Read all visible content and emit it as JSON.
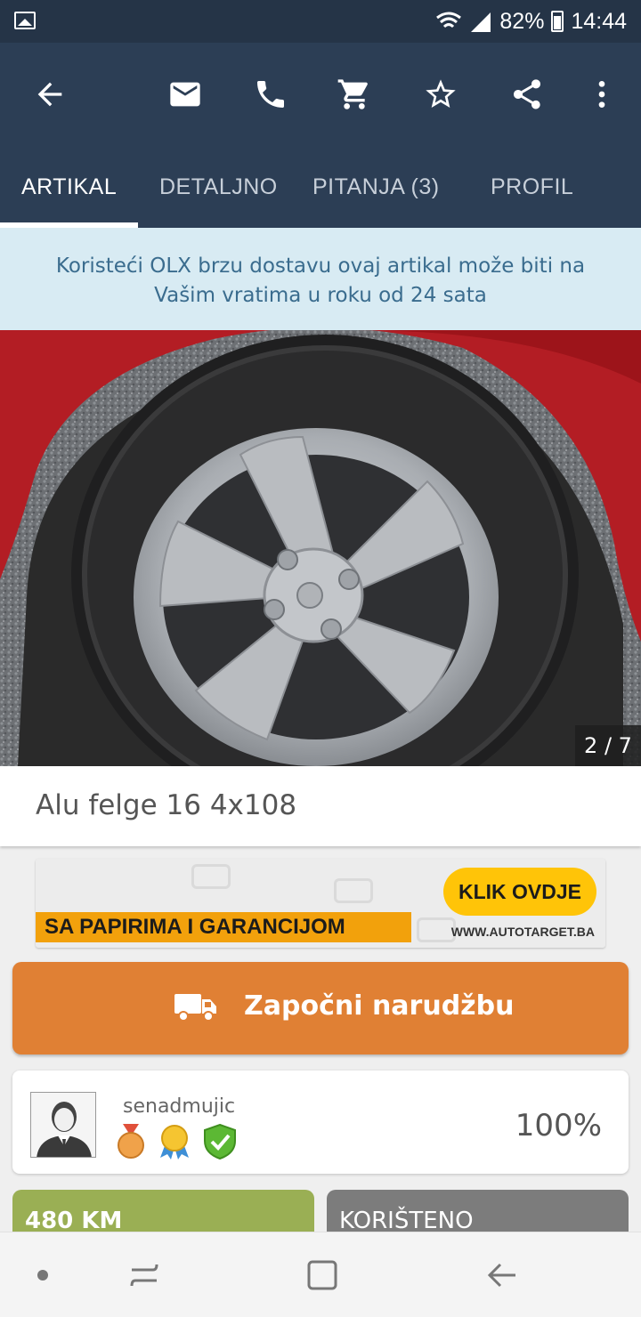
{
  "status_bar": {
    "battery": "82%",
    "time": "14:44"
  },
  "app_bar": {
    "icons": [
      "back-arrow-icon",
      "mail-icon",
      "phone-icon",
      "cart-icon",
      "star-icon",
      "share-icon",
      "more-vert-icon"
    ],
    "tabs": [
      {
        "label": "ARTIKAL",
        "active": true
      },
      {
        "label": "DETALJNO",
        "active": false
      },
      {
        "label": "PITANJA (3)",
        "active": false
      },
      {
        "label": "PROFIL",
        "active": false
      }
    ]
  },
  "info_banner": {
    "line1": "Koristeći OLX brzu dostavu ovaj artikal može biti na",
    "line2": "Vašim vratima u roku od 24 sata"
  },
  "gallery": {
    "counter": "2 / 7"
  },
  "listing": {
    "title": "Alu felge 16 4x108"
  },
  "ad": {
    "headline": "SA PAPIRIMA I GARANCIJOM",
    "cta": "KLIK OVDJE",
    "url": "WWW.AUTOTARGET.BA"
  },
  "order_button": {
    "label": "Započni narudžbu"
  },
  "seller": {
    "username": "senadmujic",
    "rating": "100%"
  },
  "cards": {
    "price": "480 KM",
    "condition": "KORIŠTENO"
  },
  "colors": {
    "app_bar": "#2c3e55",
    "banner_bg": "#d8ebf3",
    "order_button": "#e08034",
    "price_card": "#9aaf54",
    "condition_card": "#7c7c7c"
  }
}
